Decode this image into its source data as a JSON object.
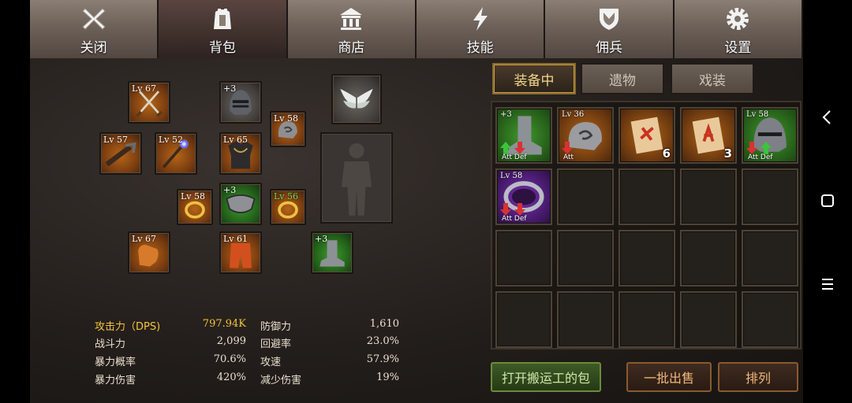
{
  "menu": {
    "tabs": [
      {
        "label": "关闭",
        "icon": "close-icon"
      },
      {
        "label": "背包",
        "icon": "backpack-icon"
      },
      {
        "label": "商店",
        "icon": "shop-icon"
      },
      {
        "label": "技能",
        "icon": "skill-lightning-icon"
      },
      {
        "label": "佣兵",
        "icon": "mercenary-shield-icon"
      },
      {
        "label": "设置",
        "icon": "gear-icon"
      }
    ],
    "active_tab": "背包"
  },
  "equipment": {
    "slots": [
      {
        "name": "weapon-swords",
        "level": "Lv 67",
        "rarity": "orange"
      },
      {
        "name": "helmet",
        "level": "+3",
        "rarity": "gray"
      },
      {
        "name": "wings",
        "level": "",
        "rarity": "gray"
      },
      {
        "name": "pauldron",
        "level": "Lv 58",
        "rarity": "orange"
      },
      {
        "name": "crossbow",
        "level": "Lv 57",
        "rarity": "orange"
      },
      {
        "name": "staff",
        "level": "Lv 52",
        "rarity": "orange"
      },
      {
        "name": "armor",
        "level": "Lv 65",
        "rarity": "orange"
      },
      {
        "name": "ring-left",
        "level": "Lv 58",
        "rarity": "orange"
      },
      {
        "name": "necklace",
        "level": "+3",
        "rarity": "green"
      },
      {
        "name": "ring-right",
        "level": "Lv 56",
        "rarity": "orange",
        "level_color": "green"
      },
      {
        "name": "gloves",
        "level": "Lv 67",
        "rarity": "orange"
      },
      {
        "name": "pants",
        "level": "Lv 61",
        "rarity": "orange"
      },
      {
        "name": "boots",
        "level": "+3",
        "rarity": "green"
      }
    ]
  },
  "stats": {
    "left": [
      {
        "label": "攻击力（DPS)",
        "value": "797.94K",
        "highlight": true
      },
      {
        "label": "战斗力",
        "value": "2,099"
      },
      {
        "label": "暴力概率",
        "value": "70.6%"
      },
      {
        "label": "暴力伤害",
        "value": "420%"
      }
    ],
    "right": [
      {
        "label": "防御力",
        "value": "1,610"
      },
      {
        "label": "回避率",
        "value": "23.0%"
      },
      {
        "label": "攻速",
        "value": "57.9%"
      },
      {
        "label": "减少伤害",
        "value": "19%"
      }
    ]
  },
  "inventory": {
    "tabs": [
      "装备中",
      "遗物",
      "戏装"
    ],
    "active_tab": "装备中",
    "items": [
      {
        "label": "+3",
        "type": "boots",
        "rarity": "green",
        "tags": "Att Def",
        "arrows": [
          "up-green",
          "down-red"
        ]
      },
      {
        "label": "Lv 36",
        "type": "pauldron",
        "rarity": "orange",
        "tags": "Att",
        "arrows": [
          "down-red"
        ]
      },
      {
        "label": "",
        "type": "scroll",
        "rarity": "orange",
        "count": "6"
      },
      {
        "label": "",
        "type": "scroll",
        "rarity": "orange",
        "count": "3"
      },
      {
        "label": "Lv 58",
        "type": "helmet",
        "rarity": "green",
        "tags": "Att Def",
        "arrows": [
          "down-red",
          "up-green"
        ]
      },
      {
        "label": "Lv 58",
        "type": "ring",
        "rarity": "purple",
        "tags": "Att Def",
        "arrows": [
          "down-red",
          "down-red"
        ]
      }
    ],
    "empty_cells": 14
  },
  "buttons": {
    "open_porter_bag": "打开搬运工的包",
    "bulk_sell": "一批出售",
    "sort": "排列"
  },
  "colors": {
    "rarity_orange": "#b56518",
    "rarity_green": "#3f9a2c",
    "rarity_purple": "#7a2fb5",
    "highlight_gold": "#f2c53d"
  }
}
